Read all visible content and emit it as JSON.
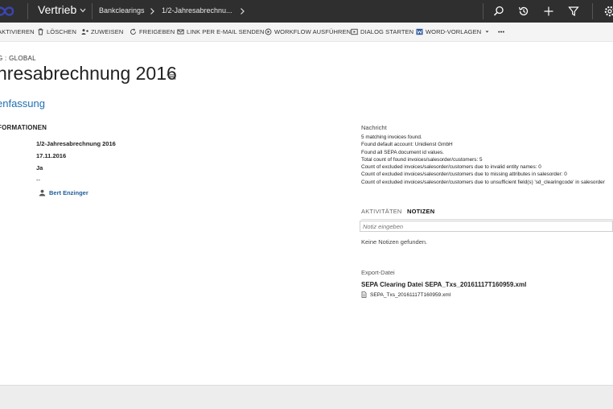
{
  "topbar": {
    "app_name": "Vertrieb",
    "breadcrumbs": [
      "Bankclearings",
      "1/2-Jahresabrechnu..."
    ],
    "icons": [
      "search-icon",
      "history-icon",
      "plus-icon",
      "filter-icon",
      "settings-icon"
    ]
  },
  "commands": [
    {
      "label": "AKTIVIEREN",
      "icon": "none"
    },
    {
      "label": "LÖSCHEN",
      "icon": "trash-icon"
    },
    {
      "label": "ZUWEISEN",
      "icon": "assign-icon"
    },
    {
      "label": "FREIGEBEN",
      "icon": "share-icon"
    },
    {
      "label": "LINK PER E-MAIL SENDEN",
      "icon": "mail-icon"
    },
    {
      "label": "WORKFLOW AUSFÜHREN",
      "icon": "workflow-icon"
    },
    {
      "label": "DIALOG STARTEN",
      "icon": "dialog-icon"
    },
    {
      "label": "WORD-VORLAGEN",
      "icon": "word-icon"
    },
    {
      "label": "•••",
      "icon": "none"
    }
  ],
  "header": {
    "entity_type": "G : GLOBAL",
    "title": "hresabrechnung 2016"
  },
  "summary": {
    "section_title": "enfassung",
    "group_title": "FORMATIONEN",
    "fields": [
      {
        "label": "",
        "value": "1/2-Jahresabrechnung 2016"
      },
      {
        "label": ":",
        "value": "17.11.2016"
      },
      {
        "label": "",
        "value": "Ja"
      },
      {
        "label": "",
        "value": "--"
      }
    ],
    "owner": "Bert Enzinger"
  },
  "message": {
    "label": "Nachricht",
    "lines": [
      "5 matching invoices found.",
      "Found default account: Unidienst GmbH",
      "Found all SEPA document id values.",
      "Total count of found invoices/salesorder/customers: 5",
      "Count of excluded invoices/salesorder/customers due to invalid entity names: 0",
      "Count of excluded invoices/salesorder/customers due to missing attributes in salesorder: 0",
      "Count of excluded invoices/salesorder/customers due to unsufficient field(s) 'sd_clearingcode' in salesorder"
    ]
  },
  "notes": {
    "tab_activities": "AKTIVITÄTEN",
    "tab_notes": "NOTIZEN",
    "placeholder": "Notiz eingeben",
    "empty_text": "Keine Notizen gefunden."
  },
  "export": {
    "label": "Export-Datei",
    "value": "SEPA Clearing Datei SEPA_Txs_20161117T160959.xml",
    "attachment": "SEPA_Txs_20161117T160959.xml"
  },
  "colors": {
    "topbar": "#2f2f2f",
    "accent": "#1f6fb1",
    "logo": "#3b46b5"
  }
}
